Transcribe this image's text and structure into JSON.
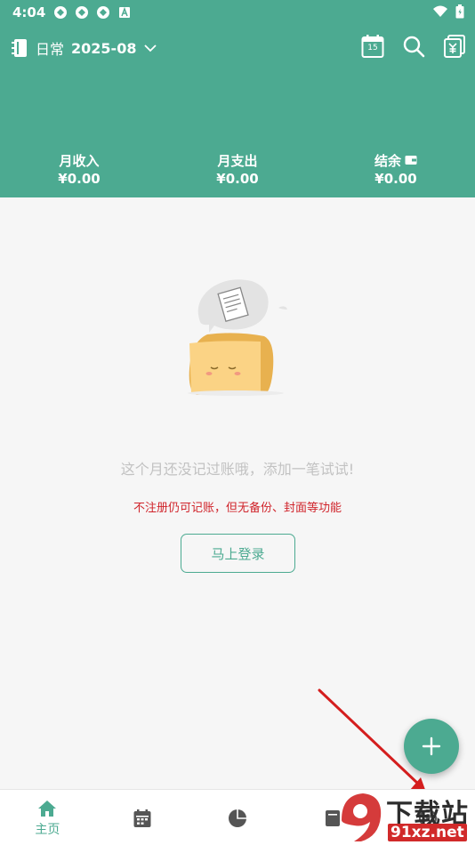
{
  "status_bar": {
    "time": "4:04"
  },
  "header": {
    "book_name": "日常",
    "month": "2025-08",
    "calendar_day": "15",
    "summary": [
      {
        "label": "月收入",
        "value": "¥0.00"
      },
      {
        "label": "月支出",
        "value": "¥0.00"
      },
      {
        "label": "结余",
        "value": "¥0.00"
      }
    ]
  },
  "empty_state": {
    "message": "这个月还没记过账哦，添加一笔试试!",
    "notice": "不注册仍可记账，但无备份、封面等功能",
    "login_label": "马上登录"
  },
  "bottom_nav": {
    "items": [
      {
        "icon": "home-icon",
        "label": "主页"
      },
      {
        "icon": "calendar-icon",
        "label": ""
      },
      {
        "icon": "pie-chart-icon",
        "label": ""
      },
      {
        "icon": "book-icon",
        "label": ""
      },
      {
        "icon": "profile-icon",
        "label": ""
      }
    ]
  },
  "watermark": {
    "top_text": "下载站",
    "bottom_text": "91xz.net"
  },
  "colors": {
    "accent": "#4caa91",
    "notice": "#d0242b",
    "background": "#f6f6f6"
  }
}
